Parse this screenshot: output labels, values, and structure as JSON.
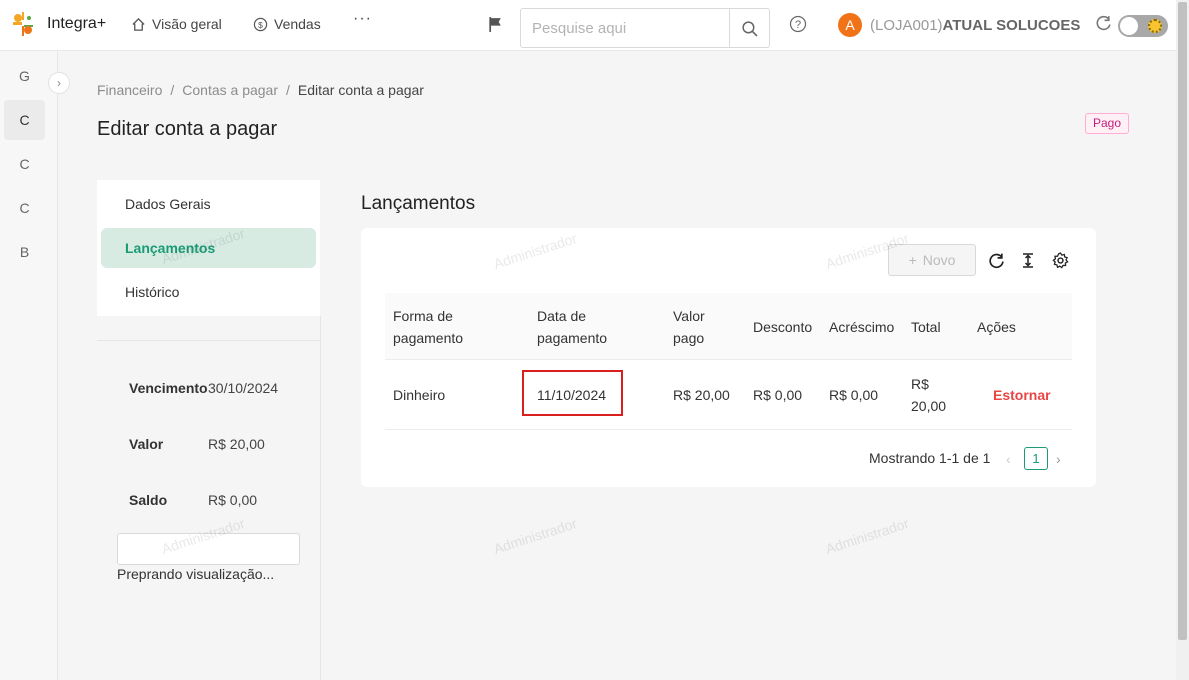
{
  "app": {
    "name": "Integra+"
  },
  "nav": {
    "overview_label": "Visão geral",
    "sales_label": "Vendas",
    "more_label": "···"
  },
  "search": {
    "placeholder": "Pesquise aqui"
  },
  "user": {
    "avatar_letter": "A",
    "store": "(LOJA001)",
    "name": "ATUAL SOLUCOES"
  },
  "mini_sidebar": {
    "items": [
      "G",
      "C",
      "C",
      "C",
      "B"
    ]
  },
  "breadcrumb": {
    "items": [
      "Financeiro",
      "Contas a pagar",
      "Editar conta a pagar"
    ],
    "separator": "/"
  },
  "page": {
    "title": "Editar conta a pagar",
    "status": "Pago"
  },
  "side_menu": {
    "items": [
      "Dados Gerais",
      "Lançamentos",
      "Histórico"
    ]
  },
  "summary": {
    "due_label": "Vencimento",
    "due_value": "30/10/2024",
    "amount_label": "Valor",
    "amount_value": "R$ 20,00",
    "balance_label": "Saldo",
    "balance_value": "R$ 0,00"
  },
  "preview": {
    "text": "Preprando visualização..."
  },
  "section": {
    "title": "Lançamentos"
  },
  "toolbar": {
    "new_label": "Novo"
  },
  "table": {
    "columns": [
      "Forma de pagamento",
      "Data de pagamento",
      "Valor pago",
      "Desconto",
      "Acréscimo",
      "Total",
      "Ações"
    ],
    "rows": [
      {
        "method": "Dinheiro",
        "date": "11/10/2024",
        "paid": "R$ 20,00",
        "discount": "R$ 0,00",
        "surcharge": "R$ 0,00",
        "total": "R$ 20,00",
        "action": "Estornar"
      }
    ]
  },
  "pagination": {
    "text": "Mostrando 1-1 de 1",
    "current_page": "1"
  },
  "watermark": "Administrador",
  "colors": {
    "accent": "#1a9b76",
    "danger": "#e84545",
    "avatar": "#f07318",
    "status_badge": "#c41d7f"
  }
}
